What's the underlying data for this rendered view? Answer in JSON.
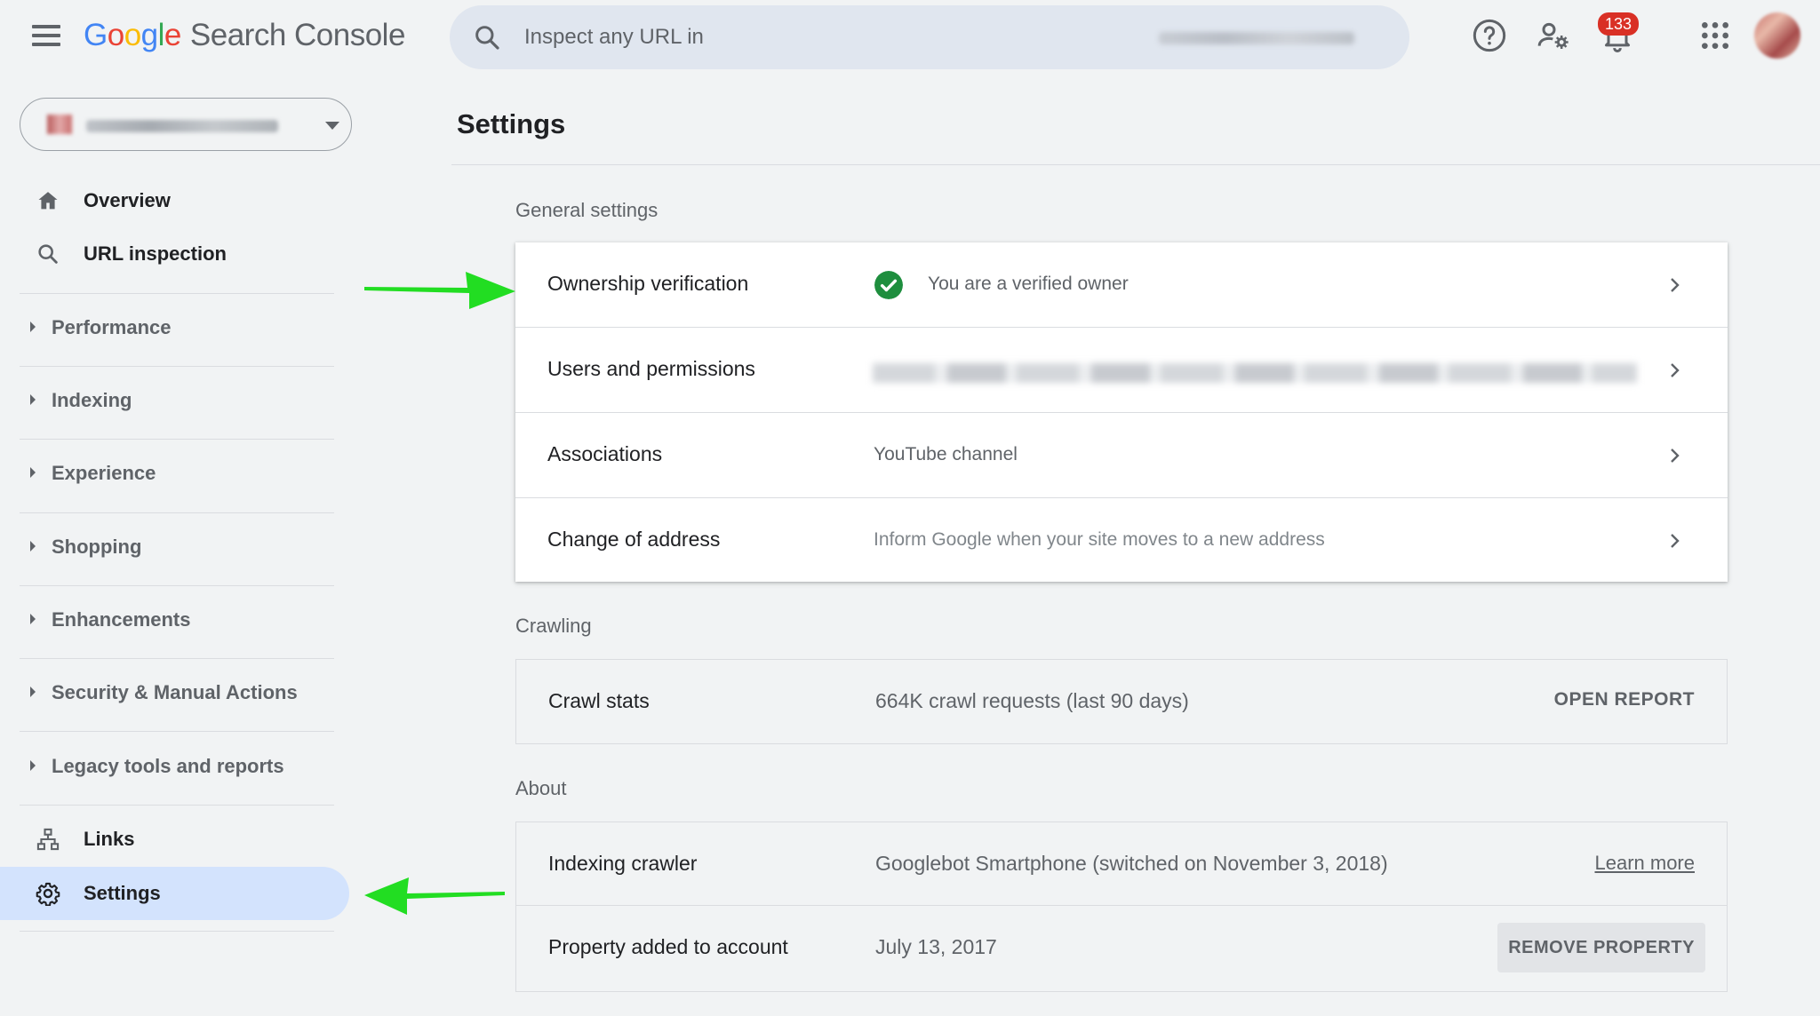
{
  "app": {
    "logo_letters": [
      "G",
      "o",
      "o",
      "g",
      "l",
      "e"
    ],
    "product_name": "Search Console"
  },
  "search": {
    "placeholder": "Inspect any URL in"
  },
  "notifications": {
    "count": "133"
  },
  "sidebar": {
    "top_items": [
      {
        "label": "Overview",
        "icon": "home-icon"
      },
      {
        "label": "URL inspection",
        "icon": "search-icon"
      }
    ],
    "groups": [
      {
        "label": "Performance"
      },
      {
        "label": "Indexing"
      },
      {
        "label": "Experience"
      },
      {
        "label": "Shopping"
      },
      {
        "label": "Enhancements"
      },
      {
        "label": "Security & Manual Actions"
      },
      {
        "label": "Legacy tools and reports"
      }
    ],
    "bottom_items": [
      {
        "label": "Links",
        "icon": "links-icon"
      },
      {
        "label": "Settings",
        "icon": "gear-icon",
        "active": true
      }
    ]
  },
  "main": {
    "title": "Settings",
    "general": {
      "heading": "General settings",
      "rows": [
        {
          "label": "Ownership verification",
          "value": "You are a verified owner"
        },
        {
          "label": "Users and permissions",
          "value": ""
        },
        {
          "label": "Associations",
          "value": "YouTube channel"
        },
        {
          "label": "Change of address",
          "value": "Inform Google when your site moves to a new address"
        }
      ]
    },
    "crawling": {
      "heading": "Crawling",
      "label": "Crawl stats",
      "value": "664K crawl requests (last 90 days)",
      "action": "OPEN REPORT"
    },
    "about": {
      "heading": "About",
      "crawler_label": "Indexing crawler",
      "crawler_value": "Googlebot Smartphone (switched on November 3, 2018)",
      "crawler_link": "Learn more",
      "added_label": "Property added to account",
      "added_value": "July 13, 2017",
      "remove_action": "REMOVE PROPERTY"
    }
  },
  "colors": {
    "accent_active": "#d3e3fd",
    "verified_green": "#1e8e3e",
    "annotation_arrow": "#22dd22",
    "badge_red": "#d93025"
  }
}
